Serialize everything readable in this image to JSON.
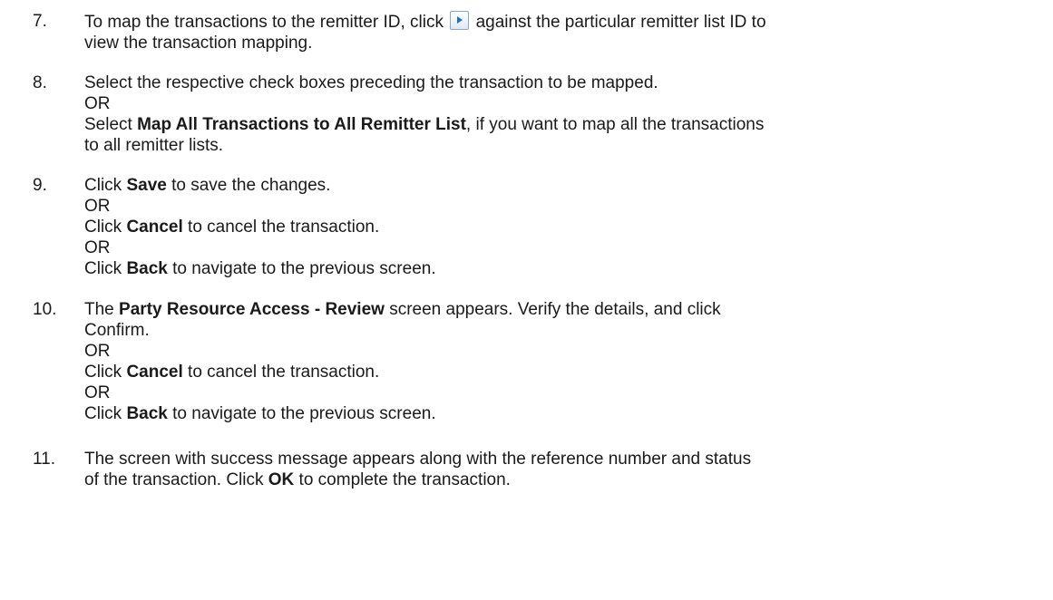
{
  "steps": [
    {
      "number": "7.",
      "line1_a": "To map the transactions to the remitter ID, click",
      "line1_b": "against the particular remitter list ID to",
      "line2": "view the transaction mapping.",
      "icon": "next-arrow-icon"
    },
    {
      "number": "8.",
      "line1": "Select the respective check boxes preceding the transaction to be mapped.",
      "or": "OR",
      "line3_a": "Select ",
      "line3_b": "Map All Transactions to All Remitter List",
      "line3_c": ", if you want to map all the transactions",
      "line4": "to all remitter lists."
    },
    {
      "number": "9.",
      "save_a": "Click ",
      "save_b": "Save",
      "save_c": " to save the changes.",
      "or1": "OR",
      "cancel_a": "Click ",
      "cancel_b": "Cancel",
      "cancel_c": " to cancel the transaction.",
      "or2": "OR",
      "back_a": "Click ",
      "back_b": "Back",
      "back_c": " to navigate to the previous screen."
    },
    {
      "number": "10.",
      "line1_a": "The ",
      "line1_b": "Party Resource Access - Review",
      "line1_c": " screen appears. Verify the details, and click",
      "line2": "Confirm.",
      "or1": "OR",
      "cancel_a": "Click ",
      "cancel_b": "Cancel",
      "cancel_c": " to cancel the transaction.",
      "or2": "OR",
      "back_a": "Click ",
      "back_b": "Back",
      "back_c": " to navigate to the previous screen."
    },
    {
      "number": "11.",
      "line1": "The screen with success message appears along with the reference number and status",
      "line2_a": "of the transaction. Click ",
      "line2_b": "OK",
      "line2_c": " to complete the transaction."
    }
  ]
}
